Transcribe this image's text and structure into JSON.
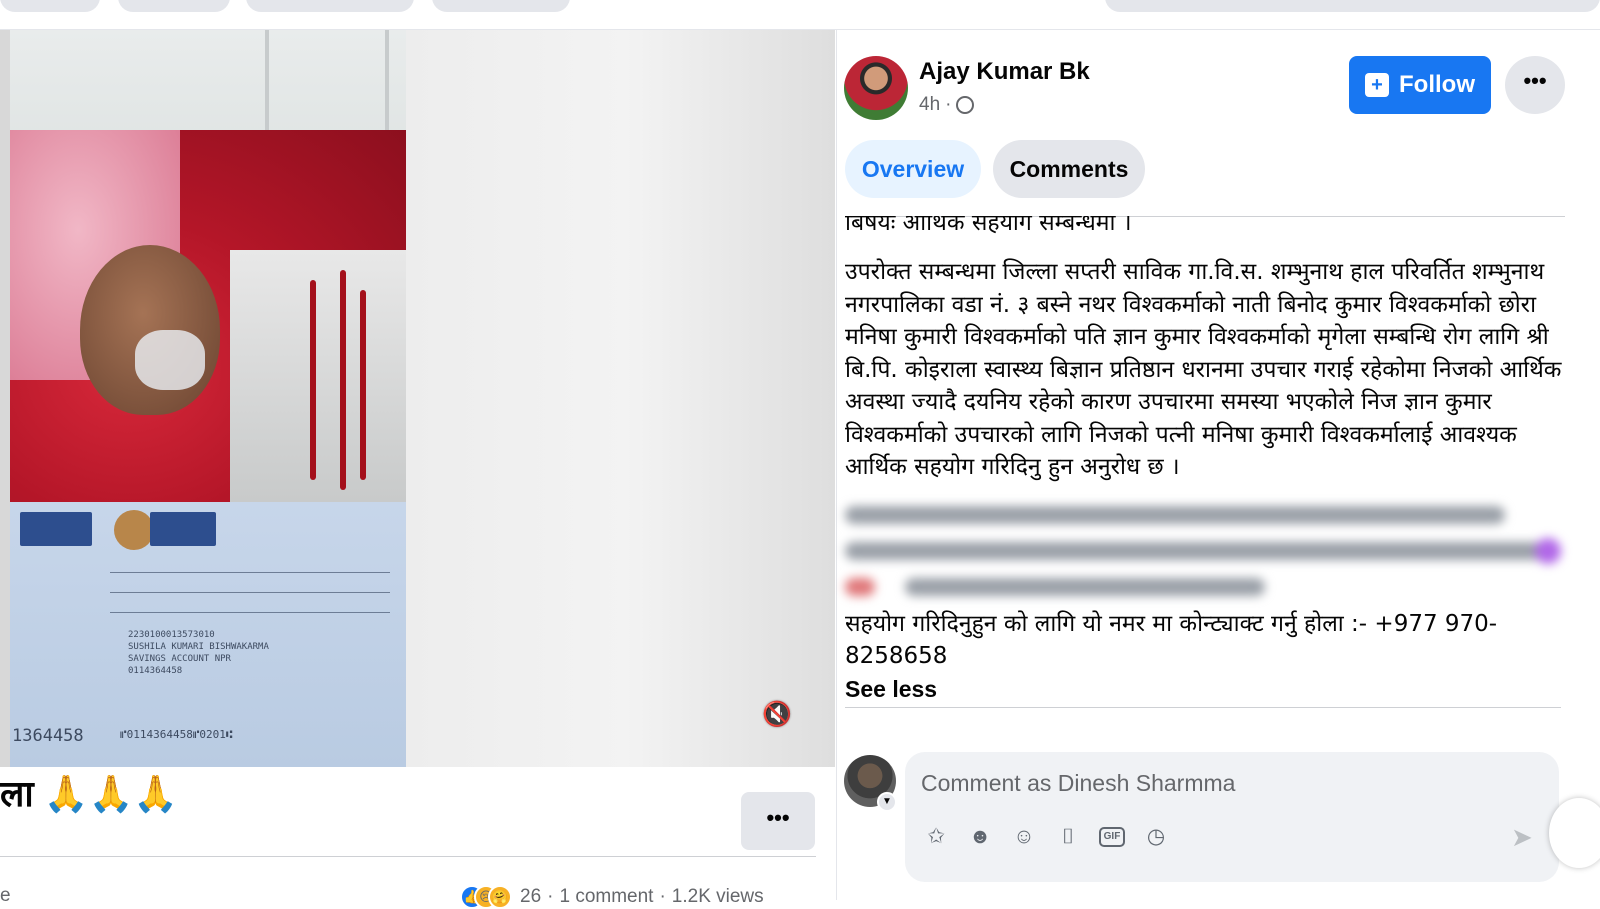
{
  "author": {
    "name": "Ajay Kumar Bk",
    "time": "4h",
    "time_separator": "·",
    "privacy_icon": "globe-icon",
    "follow_label": "Follow",
    "more_icon": "ellipsis-icon"
  },
  "tabs": [
    {
      "label": "Overview",
      "active": true
    },
    {
      "label": "Comments",
      "active": false
    }
  ],
  "post": {
    "subject": "बिषयः आर्थिक सहयोग सम्बन्धमा ।",
    "body": "उपरोक्त सम्बन्धमा जिल्ला सप्तरी साविक गा.वि.स. शम्भुनाथ हाल परिवर्तित शम्भुनाथ नगरपालिका वडा नं. ३ बस्ने नथर विश्वकर्माको नाती बिनोद कुमार विश्वकर्माको छोरा मनिषा कुमारी विश्वकर्माको पति ज्ञान कुमार विश्वकर्माको मृगेला सम्बन्धि रोग लागि श्री बि.पि. कोइराला स्वास्थ्य बिज्ञान प्रतिष्ठान धरानमा उपचार गराई रहेकोमा निजको आर्थिक अवस्था ज्यादै दयनिय रहेको कारण उपचारमा समस्या भएकोले निज ज्ञान कुमार विश्वकर्माको उपचारको लागि निजको पत्नी मनिषा कुमारी विश्वकर्मालाई आवश्यक आर्थिक सहयोग गरिदिनु हुन अनुरोध छ ।",
    "contact": "सहयोग गरिदिनुहुन को लागि यो नमर मा कोन्ट्याक्ट गर्नु होला :- +977 970-8258658",
    "see_less": "See less"
  },
  "left": {
    "caption": "ला 🙏🙏🙏",
    "more_icon": "ellipsis-icon",
    "volume_icon": "muted-speaker-icon",
    "cheque_number": "1364458",
    "cheque_account": "2230100013573010",
    "cheque_name": "SUSHILA KUMARI BISHWAKARMA",
    "cheque_type": "SAVINGS ACCOUNT NPR",
    "cheque_branch": "0114364458",
    "cheque_micr": "⑈0114364458⑈0201⑆",
    "left_edge_text": "e",
    "reactions": [
      "like",
      "sad",
      "care"
    ],
    "reaction_count": "26",
    "comments": "1 comment",
    "views": "1.2K views",
    "separator": "·"
  },
  "comment_box": {
    "placeholder": "Comment as Dinesh Sharmma",
    "icons": [
      "avatar-sticker-icon",
      "avatar-icon",
      "emoji-icon",
      "camera-icon",
      "gif-icon",
      "sticker-icon"
    ],
    "gif_label": "GIF"
  },
  "colors": {
    "accent": "#1877f2",
    "tab_active_bg": "#e7f3ff",
    "button_grey": "#e4e6eb",
    "secondary_text": "#65676b"
  }
}
